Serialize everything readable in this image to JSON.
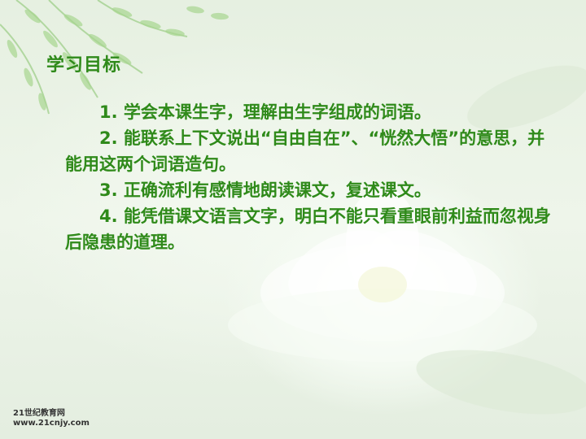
{
  "slide": {
    "title": "学习目标",
    "objectives": [
      "1. 学会本课生字，理解由生字组成的词语。",
      "2. 能联系上下文说出“自由自在”、“恍然大悟”的意思，并能用这两个词语造句。",
      "3. 正确流利有感情地朗读课文，复述课文。",
      "4. 能凭借课文语言文字，明白不能只看重眼前利益而忽视身后隐患的道理。"
    ],
    "logo": {
      "line1": "21世纪教育网",
      "line2": "www.21cnjy.com"
    }
  },
  "colors": {
    "text_green": "#2f8a1a",
    "background": "#e9f2e4"
  }
}
